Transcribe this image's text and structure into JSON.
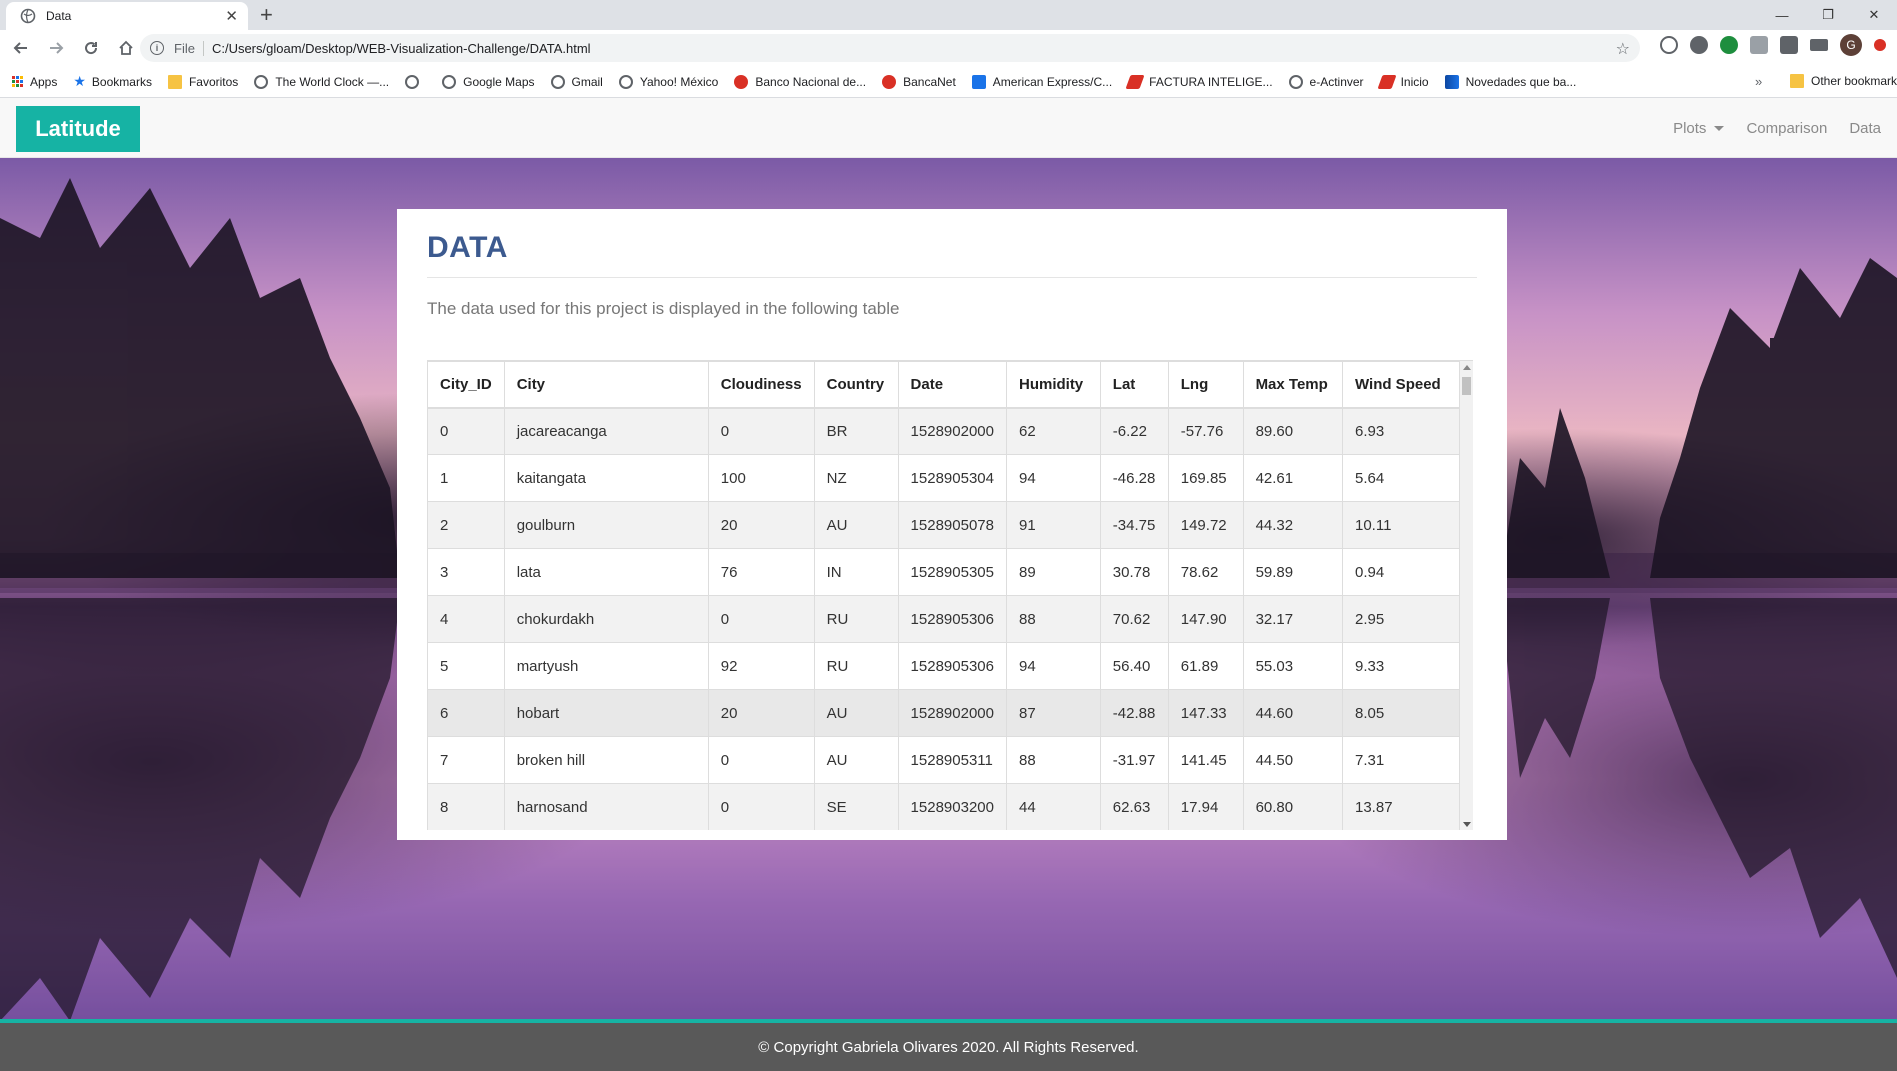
{
  "browser": {
    "tab_title": "Data",
    "new_tab": "+",
    "file_label": "File",
    "url": "C:/Users/gloam/Desktop/WEB-Visualization-Challenge/DATA.html",
    "avatar_letter": "G",
    "bookmarks": [
      {
        "label": "Apps",
        "icon": "apps-icon"
      },
      {
        "label": "Bookmarks",
        "icon": "star-icon"
      },
      {
        "label": "Favoritos",
        "icon": "folder-icon"
      },
      {
        "label": "The World Clock —...",
        "icon": "globe-icon"
      },
      {
        "label": "",
        "icon": "globe-icon"
      },
      {
        "label": "Google Maps",
        "icon": "globe-icon"
      },
      {
        "label": "Gmail",
        "icon": "globe-icon"
      },
      {
        "label": "Yahoo! México",
        "icon": "globe-icon"
      },
      {
        "label": "Banco Nacional de...",
        "icon": "bank-icon"
      },
      {
        "label": "BancaNet",
        "icon": "bank-icon"
      },
      {
        "label": "American Express/C...",
        "icon": "amex-icon"
      },
      {
        "label": "FACTURA INTELIGE...",
        "icon": "factura-icon"
      },
      {
        "label": "e-Actinver",
        "icon": "globe-icon"
      },
      {
        "label": "Inicio",
        "icon": "inicio-icon"
      },
      {
        "label": "Novedades que ba...",
        "icon": "blue-icon"
      }
    ],
    "bookmarks_more": "»",
    "other_bookmarks": "Other bookmarks"
  },
  "site": {
    "brand": "Latitude",
    "nav": {
      "plots": "Plots",
      "comparison": "Comparison",
      "data": "Data"
    }
  },
  "panel": {
    "title": "DATA",
    "description": "The data used for this project is displayed in the following table"
  },
  "table": {
    "columns": [
      "City_ID",
      "City",
      "Cloudiness",
      "Country",
      "Date",
      "Humidity",
      "Lat",
      "Lng",
      "Max Temp",
      "Wind Speed"
    ],
    "rows": [
      [
        "0",
        "jacareacanga",
        "0",
        "BR",
        "1528902000",
        "62",
        "-6.22",
        "-57.76",
        "89.60",
        "6.93"
      ],
      [
        "1",
        "kaitangata",
        "100",
        "NZ",
        "1528905304",
        "94",
        "-46.28",
        "169.85",
        "42.61",
        "5.64"
      ],
      [
        "2",
        "goulburn",
        "20",
        "AU",
        "1528905078",
        "91",
        "-34.75",
        "149.72",
        "44.32",
        "10.11"
      ],
      [
        "3",
        "lata",
        "76",
        "IN",
        "1528905305",
        "89",
        "30.78",
        "78.62",
        "59.89",
        "0.94"
      ],
      [
        "4",
        "chokurdakh",
        "0",
        "RU",
        "1528905306",
        "88",
        "70.62",
        "147.90",
        "32.17",
        "2.95"
      ],
      [
        "5",
        "martyush",
        "92",
        "RU",
        "1528905306",
        "94",
        "56.40",
        "61.89",
        "55.03",
        "9.33"
      ],
      [
        "6",
        "hobart",
        "20",
        "AU",
        "1528902000",
        "87",
        "-42.88",
        "147.33",
        "44.60",
        "8.05"
      ],
      [
        "7",
        "broken hill",
        "0",
        "AU",
        "1528905311",
        "88",
        "-31.97",
        "141.45",
        "44.50",
        "7.31"
      ],
      [
        "8",
        "harnosand",
        "0",
        "SE",
        "1528903200",
        "44",
        "62.63",
        "17.94",
        "60.80",
        "13.87"
      ]
    ]
  },
  "footer": {
    "text": "© Copyright Gabriela Olivares 2020. All Rights Reserved."
  },
  "colors": {
    "brand": "#16b3a4",
    "title": "#3c5a8f",
    "footer_bg": "#595959"
  }
}
